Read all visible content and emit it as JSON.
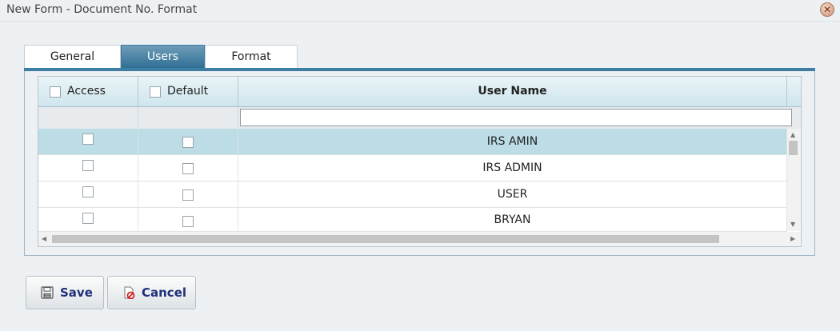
{
  "window": {
    "title": "New Form - Document No. Format",
    "close_glyph": "✕"
  },
  "tabs": [
    {
      "label": "General",
      "active": false
    },
    {
      "label": "Users",
      "active": true
    },
    {
      "label": "Format",
      "active": false
    }
  ],
  "grid": {
    "columns": {
      "access": "Access",
      "default": "Default",
      "user_name": "User Name"
    },
    "filter_value": "",
    "rows": [
      {
        "access": false,
        "default": false,
        "user_name": "IRS AMIN",
        "selected": true
      },
      {
        "access": false,
        "default": false,
        "user_name": "IRS ADMIN",
        "selected": false
      },
      {
        "access": false,
        "default": false,
        "user_name": "USER",
        "selected": false
      },
      {
        "access": false,
        "default": false,
        "user_name": "BRYAN",
        "selected": false
      }
    ]
  },
  "buttons": {
    "save": "Save",
    "cancel": "Cancel"
  },
  "icons": {
    "save": "floppy-disk-icon",
    "cancel": "cancel-document-icon",
    "close": "close-icon"
  },
  "colors": {
    "accent": "#3e7da4",
    "selected_row": "#bcdde6",
    "button_text": "#1f2f7a"
  }
}
